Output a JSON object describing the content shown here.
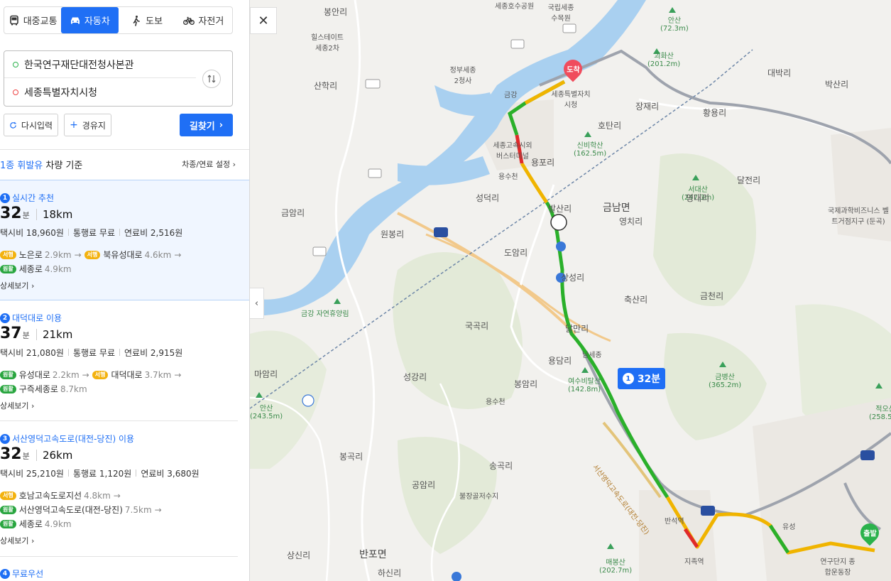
{
  "transport_modes": [
    {
      "label": "대중교통",
      "icon": "bus-icon",
      "active": false
    },
    {
      "label": "자동차",
      "icon": "car-icon",
      "active": true
    },
    {
      "label": "도보",
      "icon": "walk-icon",
      "active": false
    },
    {
      "label": "자전거",
      "icon": "bicycle-icon",
      "active": false
    }
  ],
  "route_input": {
    "start": "한국연구재단대전청사본관",
    "destination": "세종특별자치시청"
  },
  "actions": {
    "reset": "다시입력",
    "waypoint": "경유지",
    "search": "길찾기"
  },
  "vehicle": {
    "type_prefix": "1종 휘발유",
    "type_suffix": "차량 기준",
    "settings": "차종/연료 설정"
  },
  "routes": [
    {
      "num": "1",
      "title": "실시간 추천",
      "time": "32",
      "time_unit": "분",
      "distance": "18km",
      "taxi": "택시비 18,960원",
      "toll": "통행료 무료",
      "fuel": "연료비 2,516원",
      "line1": [
        {
          "badge": "서행",
          "color": "y",
          "road": "노은로",
          "km": "2.9km"
        },
        {
          "badge": "서행",
          "color": "y",
          "road": "북유성대로",
          "km": "4.6km"
        }
      ],
      "line2": [
        {
          "badge": "원활",
          "color": "g",
          "road": "세종로",
          "km": "4.9km"
        }
      ],
      "detail": "상세보기"
    },
    {
      "num": "2",
      "title": "대덕대로 이용",
      "time": "37",
      "time_unit": "분",
      "distance": "21km",
      "taxi": "택시비 21,080원",
      "toll": "통행료 무료",
      "fuel": "연료비 2,915원",
      "line1": [
        {
          "badge": "원활",
          "color": "g",
          "road": "유성대로",
          "km": "2.2km"
        },
        {
          "badge": "서행",
          "color": "y",
          "road": "대덕대로",
          "km": "3.7km"
        }
      ],
      "line2": [
        {
          "badge": "원활",
          "color": "g",
          "road": "구즉세종로",
          "km": "8.7km"
        }
      ],
      "detail": "상세보기"
    },
    {
      "num": "3",
      "title": "서산영덕고속도로(대전-당진) 이용",
      "time": "32",
      "time_unit": "분",
      "distance": "26km",
      "taxi": "택시비 25,210원",
      "toll": "통행료 1,120원",
      "fuel": "연료비 3,680원",
      "line1": [
        {
          "badge": "서행",
          "color": "y",
          "road": "호남고속도로지선",
          "km": "4.8km"
        }
      ],
      "line2": [
        {
          "badge": "원활",
          "color": "g",
          "road": "서산영덕고속도로(대전-당진)",
          "km": "7.5km"
        }
      ],
      "line3": [
        {
          "badge": "원활",
          "color": "g",
          "road": "세종로",
          "km": "4.9km"
        }
      ],
      "detail": "상세보기"
    },
    {
      "num": "4",
      "title": "무료우선"
    }
  ],
  "map": {
    "bubble_num": "1",
    "bubble_time": "32분",
    "dest_pin": "도착",
    "start_pin": "출발",
    "labels": {
      "bongan": "봉안리",
      "sejong_lake": "세종호수공원",
      "arboretum": "국립세종수목원",
      "ansan": "안산",
      "ansan_h": "(72.3m)",
      "hillstate": "힐스테이트 세종2차",
      "gov": "정부세종 2청사",
      "sanhak": "산학리",
      "geumgang": "금강",
      "hall": "세종특별자치시청",
      "goehwa": "괴화산",
      "goehwa_h": "(201.2m)",
      "daebak": "대박리",
      "baksan": "박산리",
      "jangjae": "장재리",
      "hwangyong": "황용리",
      "hotan": "호탄리",
      "sinbi": "신비학산",
      "sinbi_h": "(162.5m)",
      "terminal": "세종고속시외버스터미널",
      "yongpo": "용포리",
      "yongsucheon": "용수천",
      "gumnam": "금남면",
      "seongdeok": "성덕리",
      "balsan": "발산리",
      "yeongchi": "영치리",
      "seodae": "서대산",
      "seodae_h": "(247.3m)",
      "daljeon": "달전리",
      "yeongdae": "영대리",
      "intl_biz": "국제과학비즈니스 벨트거점지구 (둔곡)",
      "geumam": "금암리",
      "wonbong": "원봉리",
      "dongam": "도암리",
      "sangseong": "상성리",
      "chuksan": "축산리",
      "geumcheon": "금천리",
      "forest": "금강 자연휴양림",
      "gukgok": "국곡리",
      "dalman": "달만리",
      "yongdam": "용담리",
      "yeosu": "여수비탈산",
      "yeosu_h": "(142.8m)",
      "geumbyeong": "금병산",
      "geumbyeong_h": "(365.2m)",
      "maam": "마암리",
      "seonggang": "성강리",
      "bongam": "봉암리",
      "ansan2": "안산",
      "ansan2_h": "(243.5m)",
      "jeokosan": "적오산",
      "jeokosan_h": "(258.5m)",
      "bonggok": "봉곡리",
      "songgok": "송곡리",
      "gongam": "공암리",
      "reservoir": "불장골저수지",
      "banseok": "반석역",
      "yuseong": "유성",
      "maebong": "매봉산",
      "maebong_h": "(202.7m)",
      "jijok": "지족역",
      "sports": "연구단지 종합운동장",
      "sangsin": "상신리",
      "banpo": "반포면",
      "hasin": "하신리",
      "namsejong": "남세종",
      "expressway": "서산영덕고속도로(대전-당진)"
    },
    "shields": [
      "96",
      "691",
      "30",
      "1",
      "32",
      "251"
    ]
  }
}
